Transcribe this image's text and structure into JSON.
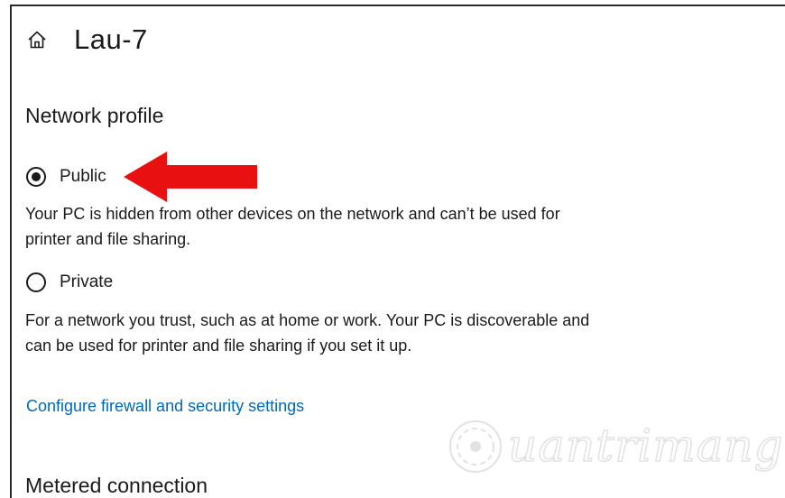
{
  "header": {
    "title": "Lau-7",
    "icon": "home-icon"
  },
  "network_profile": {
    "title": "Network profile",
    "options": [
      {
        "label": "Public",
        "selected": true,
        "description": "Your PC is hidden from other devices on the network and can’t be used for printer and file sharing."
      },
      {
        "label": "Private",
        "selected": false,
        "description": "For a network you trust, such as at home or work. Your PC is discoverable and can be used for printer and file sharing if you set it up."
      }
    ],
    "link": "Configure firewall and security settings"
  },
  "metered": {
    "title": "Metered connection"
  },
  "watermark": {
    "text": "uantrimang",
    "mark": "Q"
  },
  "colors": {
    "link": "#0067b8",
    "arrow": "#e81010",
    "text": "#1a1a1a"
  }
}
